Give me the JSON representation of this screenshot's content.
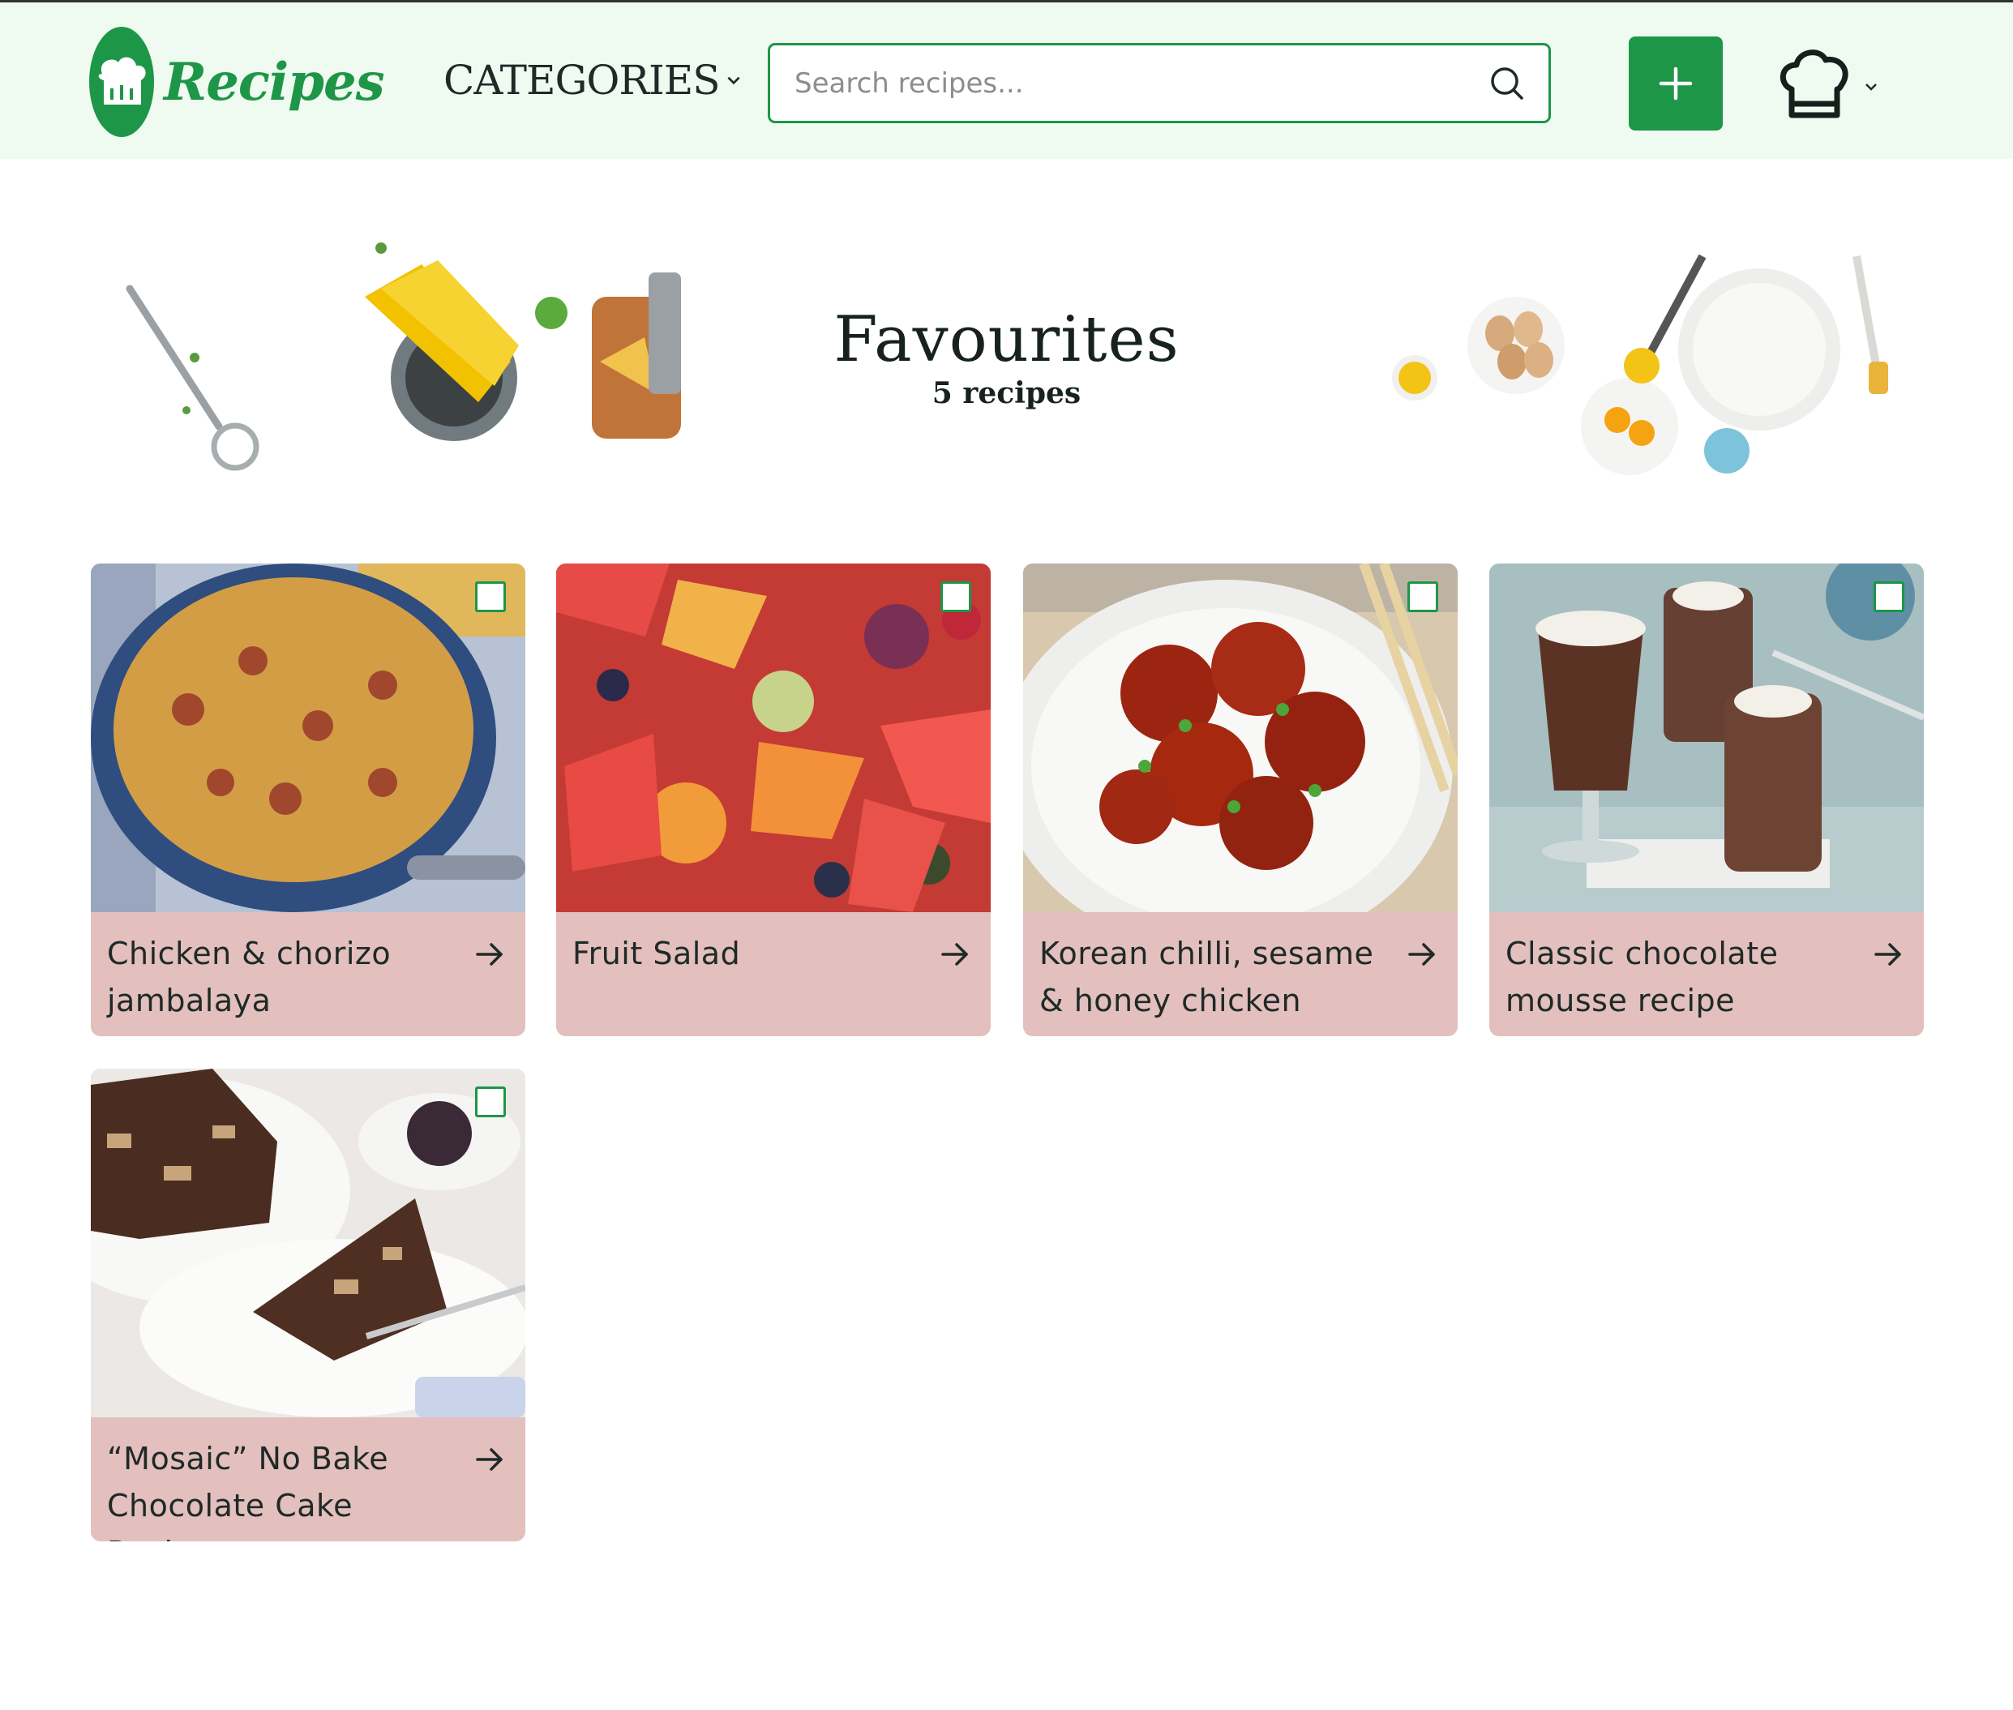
{
  "header": {
    "logo_text": "Recipes",
    "categories_label": "CATEGORIES",
    "search_placeholder": "Search recipes...",
    "icons": [
      "chef-hat-logo-icon",
      "chevron-down-icon",
      "search-icon",
      "plus-icon",
      "chef-hat-icon"
    ]
  },
  "hero": {
    "title": "Favourites",
    "subtitle": "5 recipes"
  },
  "recipes": [
    {
      "title": "Chicken & chorizo jambalaya",
      "checked": false
    },
    {
      "title": "Fruit Salad",
      "checked": false
    },
    {
      "title": "Korean chilli, sesame & honey chicken",
      "checked": false
    },
    {
      "title": "Classic chocolate mousse recipe",
      "checked": false
    },
    {
      "title": "“Mosaic” No Bake Chocolate Cake Recipe",
      "checked": false
    }
  ],
  "colors": {
    "brand_green": "#1e9647",
    "header_bg": "#effaf1",
    "card_bg": "#e3bfbd",
    "text": "#1e2a28"
  }
}
